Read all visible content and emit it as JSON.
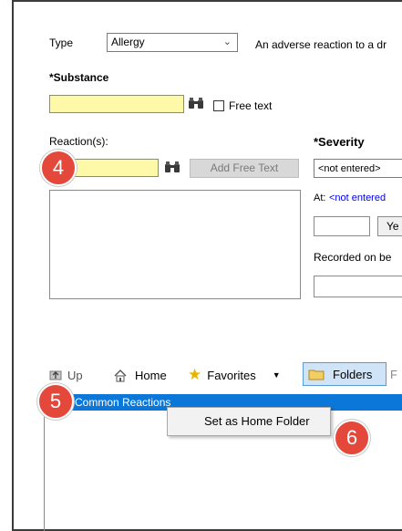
{
  "form": {
    "type_label": "Type",
    "type_value": "Allergy",
    "type_description": "An adverse reaction to a dr",
    "substance_label": "*Substance",
    "free_text_label": "Free text",
    "reactions_label": "Reaction(s):",
    "add_free_text_label": "Add Free Text",
    "severity_label": "*Severity",
    "severity_value": "<not entered>",
    "at_label": "At:",
    "at_value": "<not entered",
    "year_button": "Ye",
    "recorded_on_label": "Recorded on be"
  },
  "toolbar": {
    "up_label": "Up",
    "home_label": "Home",
    "favorites_label": "Favorites",
    "folders_label": "Folders",
    "overflow_label": "F"
  },
  "tree": {
    "common_reactions": "Common Reactions"
  },
  "context_menu": {
    "set_home_folder": "Set as Home Folder"
  },
  "badges": {
    "b4": "4",
    "b5": "5",
    "b6": "6"
  },
  "colors": {
    "badge": "#e4483a",
    "highlight_row": "#0a77d9",
    "required_field": "#fdf9a8",
    "link": "#0000ee"
  }
}
